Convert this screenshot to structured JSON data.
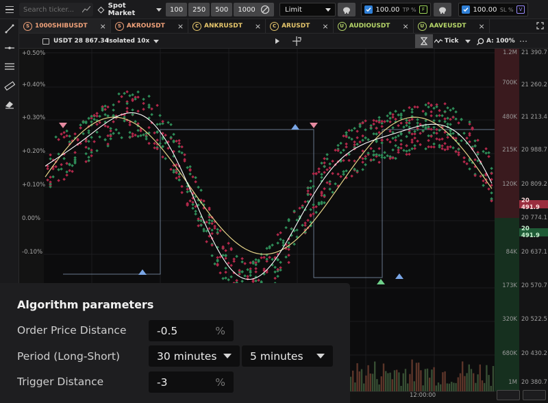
{
  "topbar": {
    "search_placeholder": "Search ticker...",
    "market": "Spot Market",
    "quantities": [
      "100",
      "250",
      "500",
      "1000"
    ],
    "order_type": "Limit",
    "tp": {
      "value": "100.00",
      "label": "TP %",
      "badge": "F"
    },
    "sl": {
      "value": "100.00",
      "label": "SL %",
      "badge": "V"
    }
  },
  "tabs": [
    {
      "symbol": "1000SHIBUSDT",
      "letter": "S",
      "color": "#f0a27a",
      "active": true
    },
    {
      "symbol": "AKROUSDT",
      "letter": "S",
      "color": "#f0a27a",
      "active": false
    },
    {
      "symbol": "ANKRUSDT",
      "letter": "C",
      "color": "#e6c66c",
      "active": false
    },
    {
      "symbol": "ARUSDT",
      "letter": "C",
      "color": "#e6c66c",
      "active": false
    },
    {
      "symbol": "AUDIOUSDT",
      "letter": "U",
      "color": "#b8d86a",
      "active": false
    },
    {
      "symbol": "AAVEUSDT",
      "letter": "U",
      "color": "#b8d86a",
      "active": false
    }
  ],
  "toolbar": {
    "balance": "USDT 28 867.34",
    "leverage": "Isolated 10x",
    "interval": "Tick",
    "zoom": "A: 100%"
  },
  "chart": {
    "y_percent_labels": [
      "+0.50%",
      "+0.40%",
      "+0.30%",
      "+0.20%",
      "+0.10%",
      "0.00%",
      "-0.10%"
    ],
    "volume_labels": [
      "1.2M",
      "700K",
      "480K",
      "215K",
      "120K",
      "84K",
      "173K",
      "320K",
      "680K",
      "1M"
    ],
    "price_labels": [
      "21 390.7",
      "21 260.2",
      "21 213.4",
      "20 988.7",
      "20 809.2",
      "20 774.1",
      "20 637.1",
      "20 570.7",
      "20 522.5",
      "20 430.2",
      "20 380.7"
    ],
    "ask_price": "20 491.9",
    "bid_price": "20 491.9",
    "time_label": "12:00:00",
    "colors": {
      "up": "#2e8b57",
      "down": "#b0284a",
      "fast": "#ffffff",
      "slow": "#e8d58a",
      "levels": "#8fa8c4"
    }
  },
  "algo": {
    "title": "Algorithm parameters",
    "order_price_distance": {
      "label": "Order Price Distance",
      "value": "-0.5",
      "unit": "%"
    },
    "period": {
      "label": "Period (Long-Short)",
      "long": "30 minutes",
      "short": "5 minutes"
    },
    "trigger_distance": {
      "label": "Trigger Distance",
      "value": "-3",
      "unit": "%"
    }
  }
}
